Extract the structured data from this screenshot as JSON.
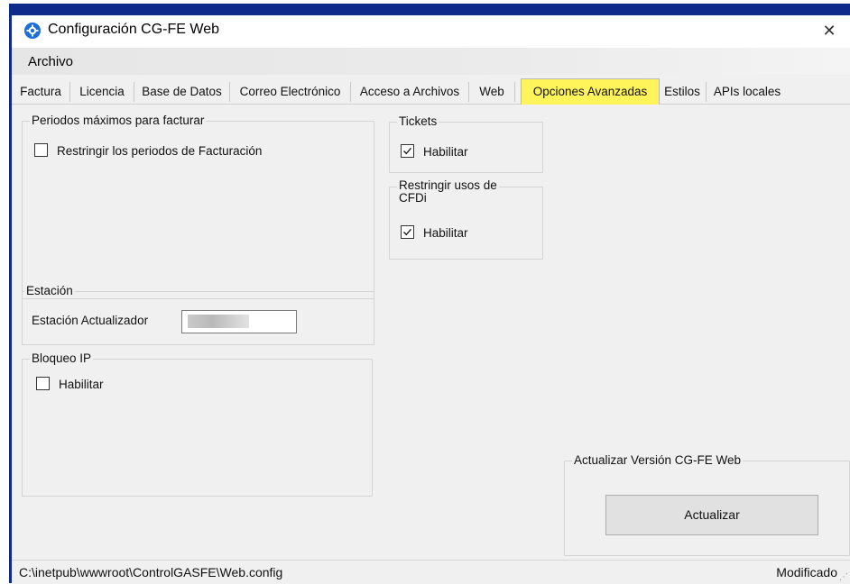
{
  "window": {
    "title": "Configuración CG-FE Web",
    "close_symbol": "✕"
  },
  "menu": {
    "items": [
      {
        "label": "Archivo"
      }
    ]
  },
  "tabs": [
    {
      "label": "Factura"
    },
    {
      "label": "Licencia"
    },
    {
      "label": "Base de Datos"
    },
    {
      "label": "Correo Electrónico"
    },
    {
      "label": "Acceso a Archivos"
    },
    {
      "label": "Web"
    },
    {
      "label": "Opciones Avanzadas",
      "active": true
    },
    {
      "label": "Estilos"
    },
    {
      "label": "APIs locales"
    }
  ],
  "highlight_color": "#fff45a",
  "periodos": {
    "title": "Periodos máximos para facturar",
    "checkbox_label": "Restringir los periodos de Facturación",
    "checked": false
  },
  "tickets": {
    "title": "Tickets",
    "checkbox_label": "Habilitar",
    "checked": true
  },
  "restringir_cfdi": {
    "title_line1": "Restringir usos de",
    "title_line2": "CFDi",
    "checkbox_label": "Habilitar",
    "checked": true
  },
  "estacion": {
    "title": "Estación",
    "field_label": "Estación Actualizador",
    "field_value": ""
  },
  "bloqueo_ip": {
    "title": "Bloqueo IP",
    "checkbox_label": "Habilitar",
    "checked": false
  },
  "actualizar": {
    "title": "Actualizar Versión CG-FE Web",
    "button_label": "Actualizar"
  },
  "statusbar": {
    "path": "C:\\inetpub\\wwwroot\\ControlGASFE\\Web.config",
    "status": "Modificado",
    "grip": "⋰"
  }
}
